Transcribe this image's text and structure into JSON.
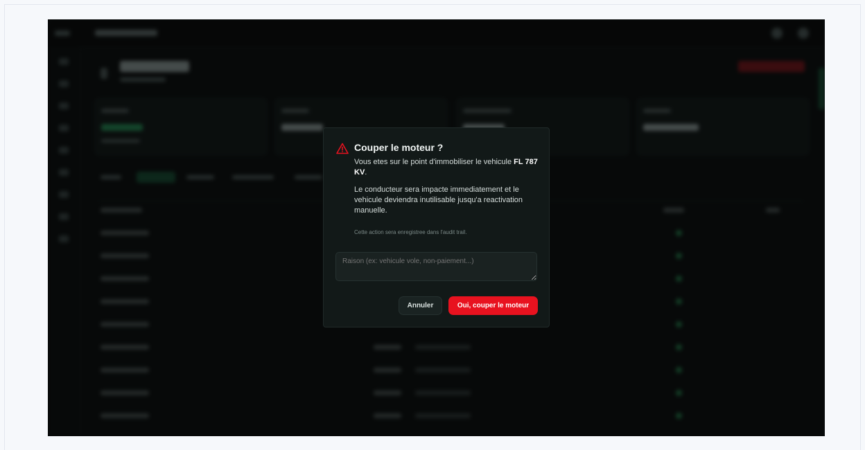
{
  "modal": {
    "icon": "warning-triangle-icon",
    "title": "Couper le moteur ?",
    "desc_prefix": "Vous etes sur le point d'immobiliser le vehicule ",
    "plate": "FL 787 KV",
    "desc_suffix": ".",
    "impact_text": "Le conducteur sera impacte immediatement et le vehicule deviendra inutilisable jusqu'a reactivation manuelle.",
    "audit_note": "Cette action sera enregistree dans l'audit trail.",
    "reason_placeholder": "Raison (ex: vehicule vole, non-paiement...)",
    "cancel_label": "Annuler",
    "confirm_label": "Oui, couper le moteur"
  },
  "colors": {
    "danger": "#e8121f",
    "modal_bg": "#121918",
    "backdrop": "#0c0f0f"
  }
}
